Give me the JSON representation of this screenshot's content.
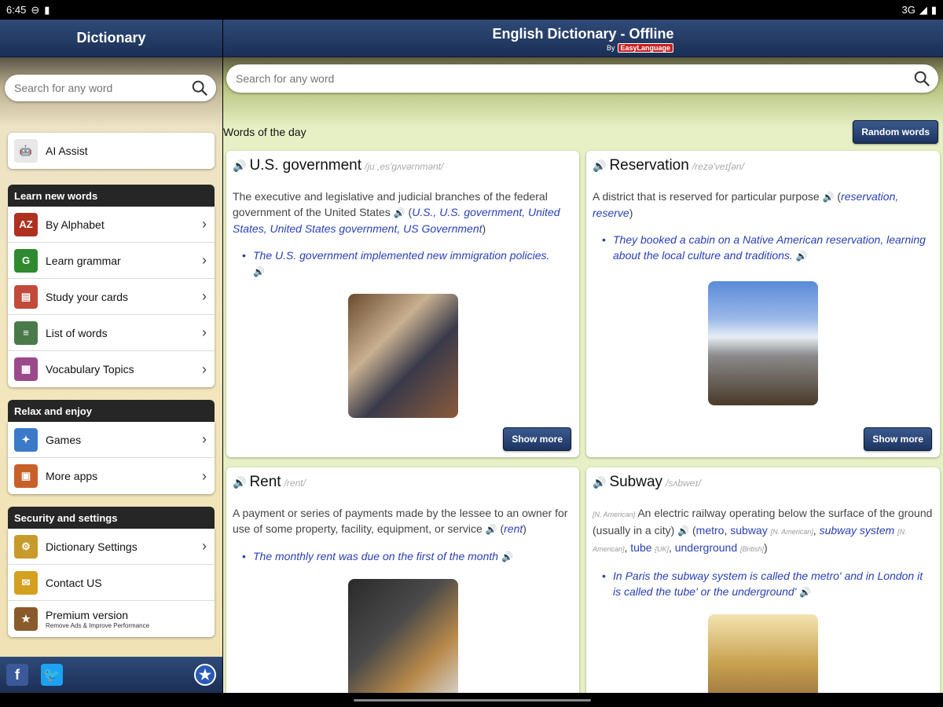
{
  "status": {
    "time": "6:45",
    "network": "3G"
  },
  "sidebar": {
    "title": "Dictionary",
    "search_placeholder": "Search for any word",
    "ai_assist": "AI Assist",
    "sections": [
      {
        "title": "Learn new words",
        "items": [
          {
            "label": "By Alphabet",
            "icon": "alphabet-icon",
            "color": "#b03020",
            "glyph": "AZ"
          },
          {
            "label": "Learn grammar",
            "icon": "grammar-icon",
            "color": "#2f8a2f",
            "glyph": "G"
          },
          {
            "label": "Study your cards",
            "icon": "cards-icon",
            "color": "#c24a3a",
            "glyph": "▤"
          },
          {
            "label": "List of words",
            "icon": "list-icon",
            "color": "#4a7a4a",
            "glyph": "≡"
          },
          {
            "label": "Vocabulary Topics",
            "icon": "topics-icon",
            "color": "#9a4a8a",
            "glyph": "▦"
          }
        ]
      },
      {
        "title": "Relax and enjoy",
        "items": [
          {
            "label": "Games",
            "icon": "games-icon",
            "color": "#3a7ac8",
            "glyph": "✦"
          },
          {
            "label": "More apps",
            "icon": "apps-icon",
            "color": "#c8602a",
            "glyph": "▣"
          }
        ]
      },
      {
        "title": "Security and settings",
        "items": [
          {
            "label": "Dictionary Settings",
            "icon": "settings-icon",
            "color": "#c89a2a",
            "glyph": "⚙"
          },
          {
            "label": "Contact US",
            "icon": "contact-icon",
            "color": "#d4a020",
            "glyph": "✉"
          },
          {
            "label": "Premium version",
            "sub": "Remove Ads & Improve Performance",
            "icon": "premium-icon",
            "color": "#8a5a2a",
            "glyph": "★"
          }
        ]
      }
    ]
  },
  "main": {
    "title": "English Dictionary - Offline",
    "by": "By",
    "brand": "EasyLanguage",
    "search_placeholder": "Search for any word",
    "words_of_day": "Words of the day",
    "random_words": "Random words",
    "show_more": "Show more"
  },
  "cards": [
    {
      "word": "U.S. government",
      "pron": "/juː,es'ɡʌvərnmənt/",
      "def": "The executive and legislative and judicial branches of the federal government of the United States",
      "syns": "U.S., U.S. government, United States, United States government, US Government",
      "example": "The U.S. government implemented new immigration policies.",
      "img_colors": [
        "#6b4a2e",
        "#c8b090",
        "#3a3a4a"
      ]
    },
    {
      "word": "Reservation",
      "pron": "/rezə'veɪʃən/",
      "def": "A district that is reserved for particular purpose",
      "syns": "reservation, reserve",
      "example": "They booked a cabin on a Native American reservation, learning about the local culture and traditions.",
      "img_colors": [
        "#5a8ad8",
        "#e8eef4",
        "#4a3a2a"
      ]
    },
    {
      "word": "Rent",
      "pron": "/rent/",
      "def": "A payment or series of payments made by the lessee to an owner for use of some property, facility, equipment, or service",
      "syns": "rent",
      "example": "The monthly rent was due on the first of the month",
      "img_colors": [
        "#2a2a2a",
        "#b8894a",
        "#d8d8d8"
      ]
    },
    {
      "word": "Subway",
      "pron": "/sʌbweɪ/",
      "tag": "[N. American]",
      "def": "An electric railway operating below the surface of the ground (usually in a city)",
      "syn_metro": "metro",
      "syn_subway": "subway",
      "syn_subway_tag": "[N. American]",
      "syn_subway_system": "subway system",
      "syn_ss_tag": "[N. American]",
      "syn_tube": "tube",
      "syn_tube_tag": "[UK]",
      "syn_underground": "underground",
      "syn_ug_tag": "[British]",
      "example": "In Paris the subway system is called the metro' and in London it is called the tube' or the underground'",
      "img_colors": [
        "#c8a050",
        "#f4e4b0",
        "#6a4a2a"
      ]
    }
  ]
}
